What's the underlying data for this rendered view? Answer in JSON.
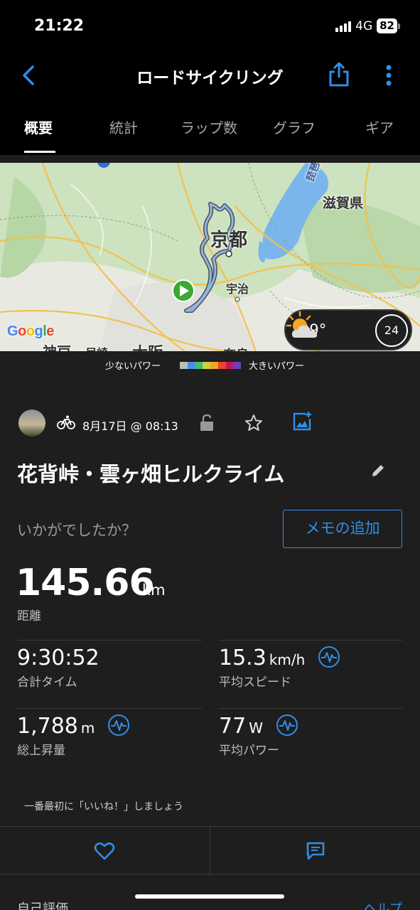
{
  "status_bar": {
    "time": "21:22",
    "network": "4G",
    "battery": "82"
  },
  "nav": {
    "title": "ロードサイクリング",
    "back_icon": "chevron-left-icon",
    "share_icon": "share-icon",
    "more_icon": "more-vertical-icon",
    "accent_color": "#2f8ee8"
  },
  "tabs": [
    {
      "label": "概要",
      "active": true
    },
    {
      "label": "統計",
      "active": false
    },
    {
      "label": "ラップ数",
      "active": false
    },
    {
      "label": "グラフ",
      "active": false
    },
    {
      "label": "ギア",
      "active": false
    }
  ],
  "map": {
    "labels": {
      "kyoto": "京都",
      "shiga": "滋賀県",
      "uji": "宇治",
      "kobe": "神戸",
      "amagasaki": "尼崎",
      "osaka": "大阪",
      "nara": "奈良",
      "biwa": "琵琶"
    },
    "provider": "Google",
    "weather": {
      "temperature": "29°",
      "icon": "partly-cloudy-sun-icon",
      "wind": "24"
    }
  },
  "power_legend": {
    "low_label": "少ないパワー",
    "high_label": "大きいパワー",
    "colors": [
      "#bdbdbd",
      "#4a90e2",
      "#3fbf6f",
      "#c6d63a",
      "#f5a623",
      "#e8452c",
      "#c2185b",
      "#6a3fc1"
    ]
  },
  "activity": {
    "sport_icon": "bicycle-icon",
    "date": "8月17日 @ 08:13",
    "title": "花背峠・雲ヶ畑ヒルクライム",
    "feeling_prompt": "いかがでしたか？",
    "memo_button": "メモの追加"
  },
  "stats": {
    "distance": {
      "value": "145.66",
      "unit": "km",
      "label": "距離"
    },
    "total_time": {
      "value": "9:30:52",
      "label": "合計タイム"
    },
    "avg_speed": {
      "value": "15.3",
      "unit": "km/h",
      "label": "平均スピード"
    },
    "ascent": {
      "value": "1,788",
      "unit": "m",
      "label": "総上昇量"
    },
    "avg_power": {
      "value": "77",
      "unit": "W",
      "label": "平均パワー"
    }
  },
  "social": {
    "like_prompt": "一番最初に「いいね！」しましょう",
    "like_icon": "heart-icon",
    "comment_icon": "comment-icon"
  },
  "footer": {
    "self_evaluation": "自己評価",
    "help": "ヘルプ"
  }
}
